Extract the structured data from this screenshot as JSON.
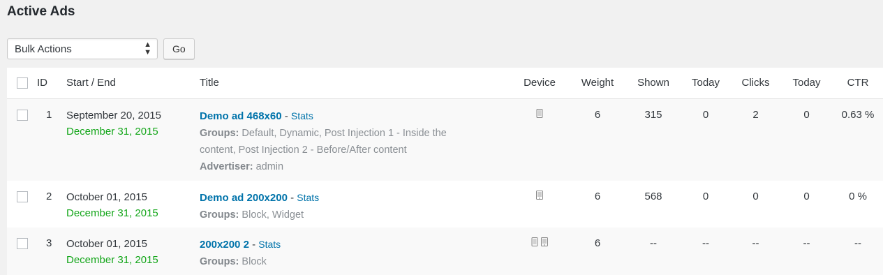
{
  "page_title": "Active Ads",
  "toolbar": {
    "bulk_actions": "Bulk Actions",
    "go_label": "Go"
  },
  "columns": {
    "id": "ID",
    "start_end": "Start / End",
    "title": "Title",
    "device": "Device",
    "weight": "Weight",
    "shown": "Shown",
    "today_shown": "Today",
    "clicks": "Clicks",
    "today_clicks": "Today",
    "ctr": "CTR"
  },
  "rows": [
    {
      "id": "1",
      "start": "September 20, 2015",
      "end": "December 31, 2015",
      "title": "Demo ad 468x60",
      "stats": "Stats",
      "separator": "-",
      "groups_label": "Groups:",
      "groups_line1": "Default, Dynamic, Post Injection 1 - Inside the",
      "groups_line2": "content, Post Injection 2 - Before/After content",
      "advertiser_label": "Advertiser:",
      "advertiser": "admin",
      "devices": [
        "mobile-icon"
      ],
      "weight": "6",
      "shown": "315",
      "today_shown": "0",
      "clicks": "2",
      "today_clicks": "0",
      "ctr": "0.63 %"
    },
    {
      "id": "2",
      "start": "October 01, 2015",
      "end": "December 31, 2015",
      "title": "Demo ad 200x200",
      "stats": "Stats",
      "separator": "-",
      "groups_label": "Groups:",
      "groups": "Block, Widget",
      "devices": [
        "tablet-icon"
      ],
      "weight": "6",
      "shown": "568",
      "today_shown": "0",
      "clicks": "0",
      "today_clicks": "0",
      "ctr": "0 %"
    },
    {
      "id": "3",
      "start": "October 01, 2015",
      "end": "December 31, 2015",
      "title": "200x200 2",
      "stats": "Stats",
      "separator": "-",
      "groups_label": "Groups:",
      "groups": "Block",
      "devices": [
        "mobile-icon",
        "tablet-icon"
      ],
      "weight": "6",
      "shown": "--",
      "today_shown": "--",
      "clicks": "--",
      "today_clicks": "--",
      "ctr": "--"
    }
  ],
  "colors": {
    "link": "#0073aa",
    "end_date": "#14a61a",
    "meta": "#8a8f94"
  }
}
